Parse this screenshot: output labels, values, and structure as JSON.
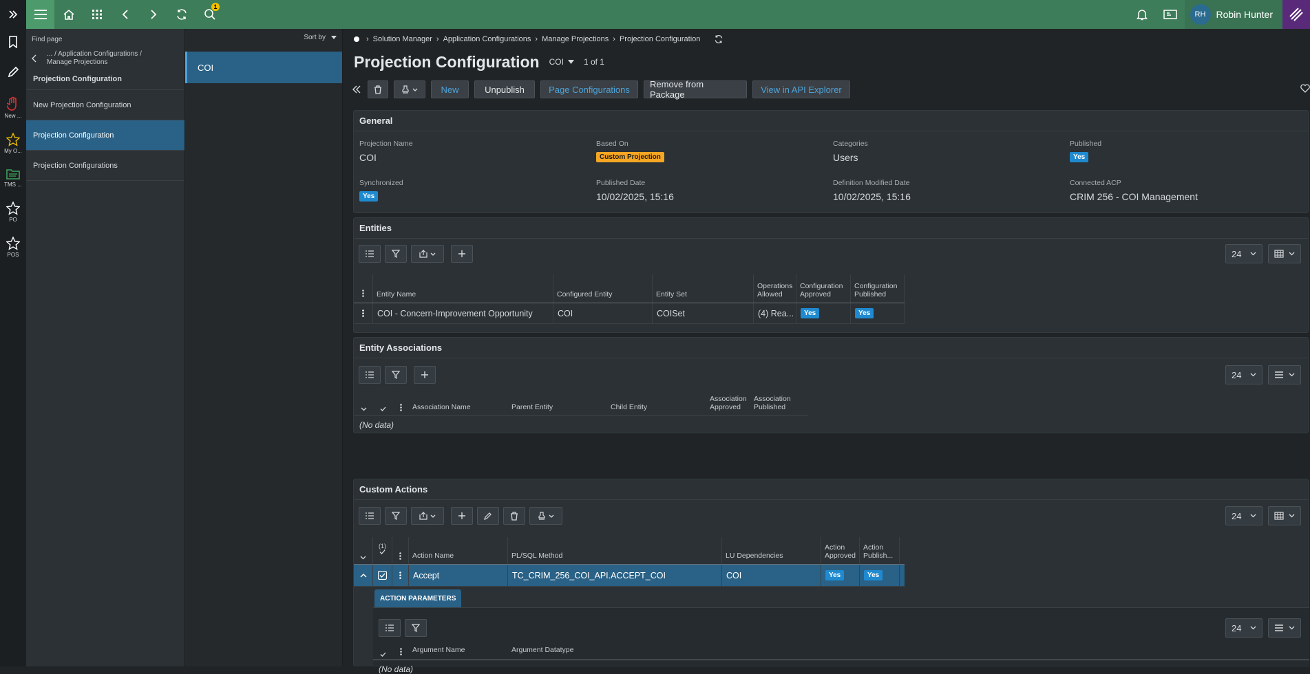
{
  "topbar": {
    "notification_count": "1",
    "user_initials": "RH",
    "user_name": "Robin Hunter"
  },
  "rail": [
    {
      "label": ""
    },
    {
      "label": ""
    },
    {
      "label": ""
    },
    {
      "label": "New ..."
    },
    {
      "label": "My O..."
    },
    {
      "label": "TMS ..."
    },
    {
      "label": "PO"
    },
    {
      "label": "POS"
    }
  ],
  "nav": {
    "find": "Find page",
    "back_path": "... / Application Configurations / Manage Projections",
    "current": "Projection Configuration",
    "items": [
      "New Projection Configuration",
      "Projection Configuration",
      "Projection Configurations"
    ]
  },
  "list": {
    "sort_label": "Sort by",
    "selected": "COI"
  },
  "breadcrumb": [
    "Solution Manager",
    "Application Configurations",
    "Manage Projections",
    "Projection Configuration"
  ],
  "header": {
    "title": "Projection Configuration",
    "key": "COI",
    "counter": "1 of 1"
  },
  "commands": {
    "new": "New",
    "unpublish": "Unpublish",
    "page_config": "Page Configurations",
    "remove_pkg": "Remove from Package",
    "api_explorer": "View in API Explorer"
  },
  "general": {
    "title": "General",
    "projection_name_label": "Projection Name",
    "projection_name": "COI",
    "based_on_label": "Based On",
    "based_on": "Custom Projection",
    "categories_label": "Categories",
    "categories": "Users",
    "published_label": "Published",
    "published": "Yes",
    "synchronized_label": "Synchronized",
    "synchronized": "Yes",
    "published_date_label": "Published Date",
    "published_date": "10/02/2025, 15:16",
    "def_modified_label": "Definition Modified Date",
    "def_modified": "10/02/2025, 15:16",
    "connected_acp_label": "Connected ACP",
    "connected_acp": "CRIM 256 - COI Management"
  },
  "entities": {
    "title": "Entities",
    "page_size": "24",
    "columns": [
      "Entity Name",
      "Configured Entity",
      "Entity Set",
      "Operations Allowed",
      "Configuration Approved",
      "Configuration Published"
    ],
    "rows": [
      {
        "name": "COI - Concern-Improvement Opportunity",
        "configured": "COI",
        "set": "COISet",
        "ops": "(4) Rea...",
        "approved": "Yes",
        "published": "Yes"
      }
    ]
  },
  "associations": {
    "title": "Entity Associations",
    "page_size": "24",
    "columns": [
      "Association Name",
      "Parent Entity",
      "Child Entity",
      "Association Approved",
      "Association Published"
    ],
    "no_data": "(No data)"
  },
  "custom_actions": {
    "title": "Custom Actions",
    "page_size": "24",
    "selected_count": "(1)",
    "columns": [
      "Action Name",
      "PL/SQL Method",
      "LU Dependencies",
      "Action Approved",
      "Action Publish..."
    ],
    "rows": [
      {
        "name": "Accept",
        "method": "TC_CRIM_256_COI_API.ACCEPT_COI",
        "lu": "COI",
        "approved": "Yes",
        "published": "Yes"
      }
    ]
  },
  "action_params": {
    "tab": "ACTION PARAMETERS",
    "page_size": "24",
    "columns": [
      "Argument Name",
      "Argument Datatype"
    ],
    "no_data": "(No data)"
  }
}
